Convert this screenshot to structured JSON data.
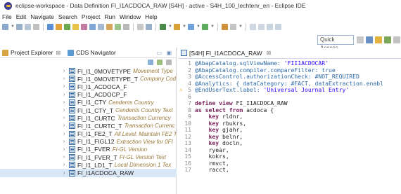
{
  "window": {
    "title": "eclipse-workspace - Data Definition FI_I1ACDOCA_RAW [S4H] - active - S4H_100_lechtenr_en - Eclipse IDE"
  },
  "menu": [
    "File",
    "Edit",
    "Navigate",
    "Search",
    "Project",
    "Run",
    "Window",
    "Help"
  ],
  "quick_access": {
    "placeholder": "Quick Access"
  },
  "left_panel": {
    "tabs": [
      {
        "label": "Project Explorer",
        "close": "⊠"
      },
      {
        "label": "CDS Navigator",
        "close": ""
      }
    ],
    "tree": [
      {
        "name": "FI_I1_0MOVETYPE",
        "desc": "Movement Type"
      },
      {
        "name": "FI_I1_0MOVETYPE_T",
        "desc": "Company Cod"
      },
      {
        "name": "FI_I1_ACDOCA_F",
        "desc": ""
      },
      {
        "name": "FI_I1_ACDOCP_F",
        "desc": ""
      },
      {
        "name": "FI_I1_CTY",
        "desc": "Cendents Country"
      },
      {
        "name": "FI_I1_CTY_T",
        "desc": "Cendents Country Text"
      },
      {
        "name": "FI_I1_CURTC",
        "desc": "Transaction Currency"
      },
      {
        "name": "FI_I1_CURTC_T",
        "desc": "Transaction Currenc"
      },
      {
        "name": "FI_I1_FE2_T",
        "desc": "All Level: Maintain FE2 T"
      },
      {
        "name": "FI_I1_FIGL12",
        "desc": "Extraction View for 0FI"
      },
      {
        "name": "FI_I1_FVER",
        "desc": "FI-GL Version"
      },
      {
        "name": "FI_I1_FVER_T",
        "desc": "FI-GL Version Text"
      },
      {
        "name": "FI_I1_LD1_T",
        "desc": "Local Dimension 1 Tex"
      },
      {
        "name": "FI_I1ACDOCA_RAW",
        "desc": ""
      }
    ]
  },
  "editor": {
    "tab_label": "[S4H] FI_I1ACDOCA_RAW",
    "tab_close": "⊠",
    "lines": [
      {
        "n": "1",
        "parts": [
          {
            "c": "ann",
            "t": "@AbapCatalog.sqlViewName: "
          },
          {
            "c": "str",
            "t": "'FII1ACDOCAR'"
          }
        ]
      },
      {
        "n": "2",
        "parts": [
          {
            "c": "ann",
            "t": "@AbapCatalog.compiler.compareFilter: true"
          }
        ]
      },
      {
        "n": "3",
        "parts": [
          {
            "c": "ann",
            "t": "@AccessControl.authorizationCheck: #NOT_REQUIRED"
          }
        ]
      },
      {
        "n": "4",
        "parts": [
          {
            "c": "ann",
            "t": "@Analytics: { dataCategory: #FACT, dataExtraction.enabl"
          }
        ]
      },
      {
        "n": "5",
        "warn": "⚠",
        "parts": [
          {
            "c": "ann",
            "t": "@EndUserText.label: "
          },
          {
            "c": "str",
            "t": "'Universal Journal Entry'"
          }
        ]
      },
      {
        "n": "6",
        "parts": [
          {
            "c": "tx",
            "t": ""
          }
        ]
      },
      {
        "n": "7",
        "parts": [
          {
            "c": "kw",
            "t": "define view "
          },
          {
            "c": "tx",
            "t": "FI_I1ACDOCA_RAW"
          }
        ]
      },
      {
        "n": "8",
        "parts": [
          {
            "c": "kw",
            "t": "as select from "
          },
          {
            "c": "tx",
            "t": "acdoca {"
          }
        ]
      },
      {
        "n": "9",
        "parts": [
          {
            "c": "kw",
            "t": "    key "
          },
          {
            "c": "tx",
            "t": "rldnr,"
          }
        ]
      },
      {
        "n": "10",
        "parts": [
          {
            "c": "kw",
            "t": "    key "
          },
          {
            "c": "tx",
            "t": "rbukrs,"
          }
        ]
      },
      {
        "n": "11",
        "parts": [
          {
            "c": "kw",
            "t": "    key "
          },
          {
            "c": "tx",
            "t": "gjahr,"
          }
        ]
      },
      {
        "n": "12",
        "parts": [
          {
            "c": "kw",
            "t": "    key "
          },
          {
            "c": "tx",
            "t": "belnr,"
          }
        ]
      },
      {
        "n": "13",
        "parts": [
          {
            "c": "kw",
            "t": "    key "
          },
          {
            "c": "tx",
            "t": "docln,"
          }
        ]
      },
      {
        "n": "14",
        "parts": [
          {
            "c": "tx",
            "t": "    ryear,"
          }
        ]
      },
      {
        "n": "15",
        "parts": [
          {
            "c": "tx",
            "t": "    kokrs,"
          }
        ]
      },
      {
        "n": "16",
        "parts": [
          {
            "c": "tx",
            "t": "    rmvct,"
          }
        ]
      },
      {
        "n": "17",
        "parts": [
          {
            "c": "tx",
            "t": "    racct,"
          }
        ]
      }
    ]
  },
  "colors": {
    "accent": "#3a6ea5",
    "selection": "#d9e6f5",
    "annotation": "#2e6aa8",
    "keyword": "#7a1f5a",
    "string": "#2a00ff"
  }
}
